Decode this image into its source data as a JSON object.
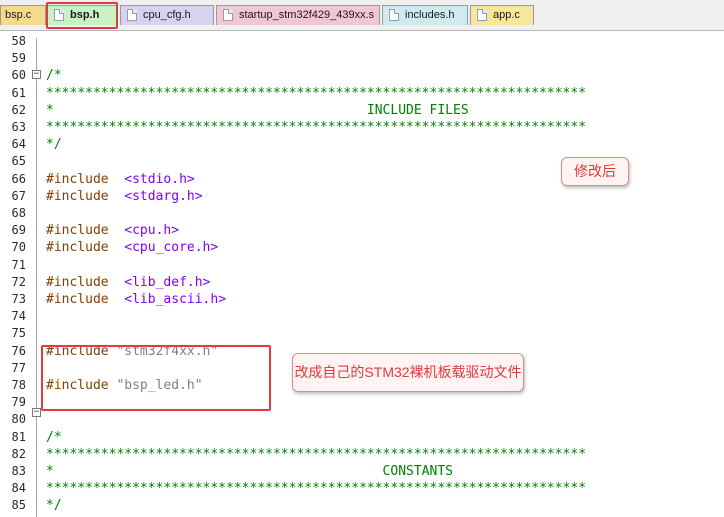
{
  "tabs": [
    {
      "label": "bsp.c",
      "active": false,
      "color": "#f7d98e",
      "icon": false
    },
    {
      "label": "bsp.h",
      "active": true,
      "color": "#c8f2c3",
      "icon": true
    },
    {
      "label": "cpu_cfg.h",
      "active": false,
      "color": "#d7d2f2",
      "icon": true
    },
    {
      "label": "startup_stm32f429_439xx.s",
      "active": false,
      "color": "#f4c6d1",
      "icon": true
    },
    {
      "label": "includes.h",
      "active": false,
      "color": "#cdebf1",
      "icon": true
    },
    {
      "label": "app.c",
      "active": false,
      "color": "#f7e79a",
      "icon": true
    }
  ],
  "lines": [
    {
      "n": "58",
      "t": ""
    },
    {
      "n": "59",
      "t": ""
    },
    {
      "n": "60",
      "t": "/*"
    },
    {
      "n": "61",
      "t": "*********************************************************************"
    },
    {
      "n": "62",
      "t": "*                                        INCLUDE FILES"
    },
    {
      "n": "63",
      "t": "*********************************************************************"
    },
    {
      "n": "64",
      "t": "*/"
    },
    {
      "n": "65",
      "t": ""
    },
    {
      "n": "66",
      "pp": "#include",
      "h": "<stdio.h>"
    },
    {
      "n": "67",
      "pp": "#include",
      "h": "<stdarg.h>"
    },
    {
      "n": "68",
      "t": ""
    },
    {
      "n": "69",
      "pp": "#include",
      "h": "<cpu.h>"
    },
    {
      "n": "70",
      "pp": "#include",
      "h": "<cpu_core.h>"
    },
    {
      "n": "71",
      "t": ""
    },
    {
      "n": "72",
      "pp": "#include",
      "h": "<lib_def.h>"
    },
    {
      "n": "73",
      "pp": "#include",
      "h": "<lib_ascii.h>"
    },
    {
      "n": "74",
      "t": ""
    },
    {
      "n": "75",
      "t": ""
    },
    {
      "n": "76",
      "pp": "#include",
      "s": "\"stm32f4xx.h\""
    },
    {
      "n": "77",
      "t": ""
    },
    {
      "n": "78",
      "pp": "#include",
      "s": "\"bsp_led.h\""
    },
    {
      "n": "79",
      "t": ""
    },
    {
      "n": "80",
      "t": ""
    },
    {
      "n": "81",
      "t": "/*"
    },
    {
      "n": "82",
      "t": "*********************************************************************"
    },
    {
      "n": "83",
      "t": "*                                          CONSTANTS"
    },
    {
      "n": "84",
      "t": "*********************************************************************"
    },
    {
      "n": "85",
      "t": "*/"
    }
  ],
  "annotations": {
    "modified": "修改后",
    "note": "改成自己的STM32裸机板载驱动文件"
  },
  "colors": {
    "comment": "#008000",
    "preprocessor": "#804000",
    "header": "#8000ff",
    "string": "#808080",
    "highlight_box": "#e03c3c"
  }
}
